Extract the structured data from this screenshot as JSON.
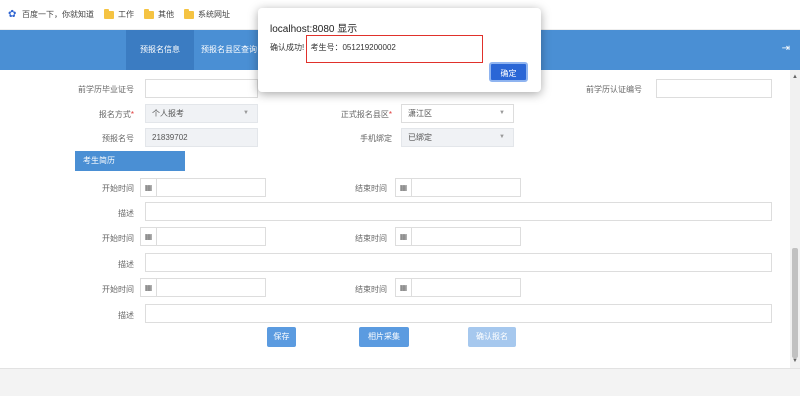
{
  "bookmarks": [
    {
      "label": "百度一下，你就知道",
      "icon": "paw-icon"
    },
    {
      "label": "工作",
      "icon": "folder-icon"
    },
    {
      "label": "其他",
      "icon": "folder-icon"
    },
    {
      "label": "系统网址",
      "icon": "folder-icon"
    }
  ],
  "nav": {
    "tabs": [
      {
        "label": "预报名信息",
        "active": true
      },
      {
        "label": "预报名县区查询",
        "active": false
      }
    ],
    "exit_icon": "logout-icon"
  },
  "form": {
    "prev_cert_label": "前学历毕业证号",
    "prev_cert_value": "",
    "prev_auth_label": "前学历认证编号",
    "prev_auth_value": "",
    "signup_mode_label": "报名方式",
    "signup_mode_value": "个人报考",
    "county_label": "正式报名县区",
    "county_value": "潇江区",
    "prereg_no_label": "预报名号",
    "prereg_no_value": "21839702",
    "phone_bind_label": "手机绑定",
    "phone_bind_value": "已绑定",
    "resume_tab": "考生简历",
    "resume_rows": [
      {
        "start_label": "开始时间",
        "end_label": "结束时间",
        "desc_label": "描述",
        "start": "",
        "end": "",
        "desc": ""
      },
      {
        "start_label": "开始时间",
        "end_label": "结束时间",
        "desc_label": "描述",
        "start": "",
        "end": "",
        "desc": ""
      },
      {
        "start_label": "开始时间",
        "end_label": "结束时间",
        "desc_label": "描述",
        "start": "",
        "end": "",
        "desc": ""
      }
    ]
  },
  "buttons": {
    "save": "保存",
    "photo": "相片采集",
    "confirm": "确认报名"
  },
  "dialog": {
    "title": "localhost:8080 显示",
    "message_prefix": "确认成功!",
    "message_main": "考生号：051219200002",
    "ok": "确定"
  },
  "colors": {
    "nav": "#4a8fd4",
    "button": "#5b9be0",
    "required": "#e03b3b",
    "highlight": "#e0312b",
    "dialog_ok": "#2a66d6"
  }
}
